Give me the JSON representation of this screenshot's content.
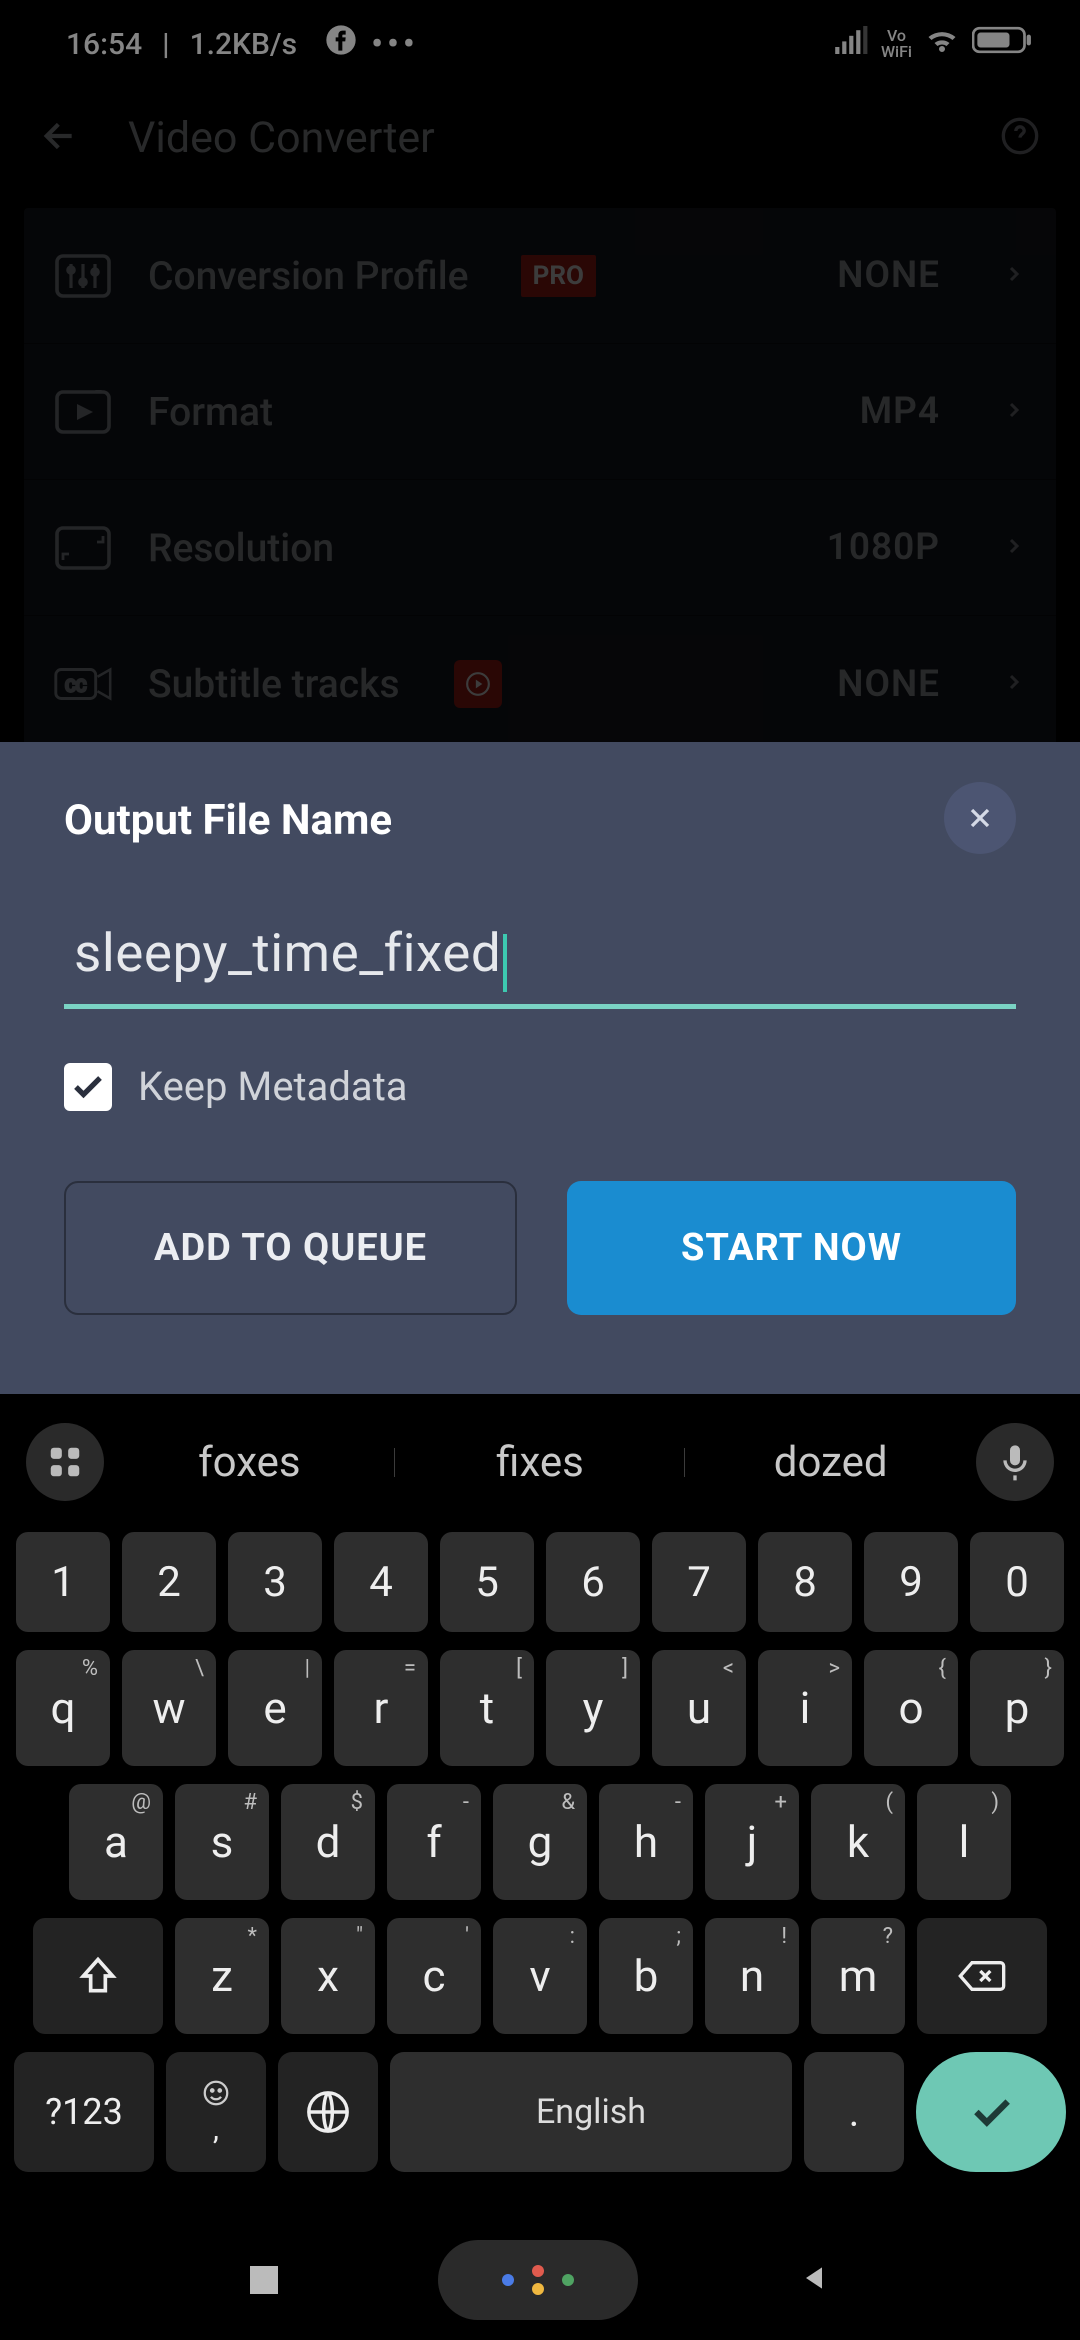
{
  "status": {
    "time": "16:54",
    "net_speed": "1.2KB/s",
    "vowifi_label": "Vo\nWiFi"
  },
  "header": {
    "title": "Video Converter"
  },
  "settings": [
    {
      "label": "Conversion Profile",
      "value": "NONE",
      "badge": "PRO",
      "badge_type": "text"
    },
    {
      "label": "Format",
      "value": "MP4"
    },
    {
      "label": "Resolution",
      "value": "1080P"
    },
    {
      "label": "Subtitle tracks",
      "value": "NONE",
      "badge_type": "play"
    }
  ],
  "sheet": {
    "title": "Output File Name",
    "filename": "sleepy_time_fixed",
    "keep_metadata_label": "Keep Metadata",
    "keep_metadata_checked": true,
    "add_to_queue": "ADD TO QUEUE",
    "start_now": "START NOW"
  },
  "keyboard": {
    "suggestions": [
      "foxes",
      "fixes",
      "dozed"
    ],
    "row_num": [
      "1",
      "2",
      "3",
      "4",
      "5",
      "6",
      "7",
      "8",
      "9",
      "0"
    ],
    "row_top": [
      {
        "k": "q",
        "s": "%"
      },
      {
        "k": "w",
        "s": "\\"
      },
      {
        "k": "e",
        "s": "|"
      },
      {
        "k": "r",
        "s": "="
      },
      {
        "k": "t",
        "s": "["
      },
      {
        "k": "y",
        "s": "]"
      },
      {
        "k": "u",
        "s": "<"
      },
      {
        "k": "i",
        "s": ">"
      },
      {
        "k": "o",
        "s": "{"
      },
      {
        "k": "p",
        "s": "}"
      }
    ],
    "row_mid": [
      {
        "k": "a",
        "s": "@"
      },
      {
        "k": "s",
        "s": "#"
      },
      {
        "k": "d",
        "s": "$"
      },
      {
        "k": "f",
        "s": "-"
      },
      {
        "k": "g",
        "s": "&"
      },
      {
        "k": "h",
        "s": "-"
      },
      {
        "k": "j",
        "s": "+"
      },
      {
        "k": "k",
        "s": "("
      },
      {
        "k": "l",
        "s": ")"
      }
    ],
    "row_bot": [
      {
        "k": "z",
        "s": "*"
      },
      {
        "k": "x",
        "s": "\""
      },
      {
        "k": "c",
        "s": "'"
      },
      {
        "k": "v",
        "s": ":"
      },
      {
        "k": "b",
        "s": ";"
      },
      {
        "k": "n",
        "s": "!"
      },
      {
        "k": "m",
        "s": "?"
      }
    ],
    "sym_label": "?123",
    "space_label": "English",
    "dot_label": ".",
    "comma_label": ","
  }
}
